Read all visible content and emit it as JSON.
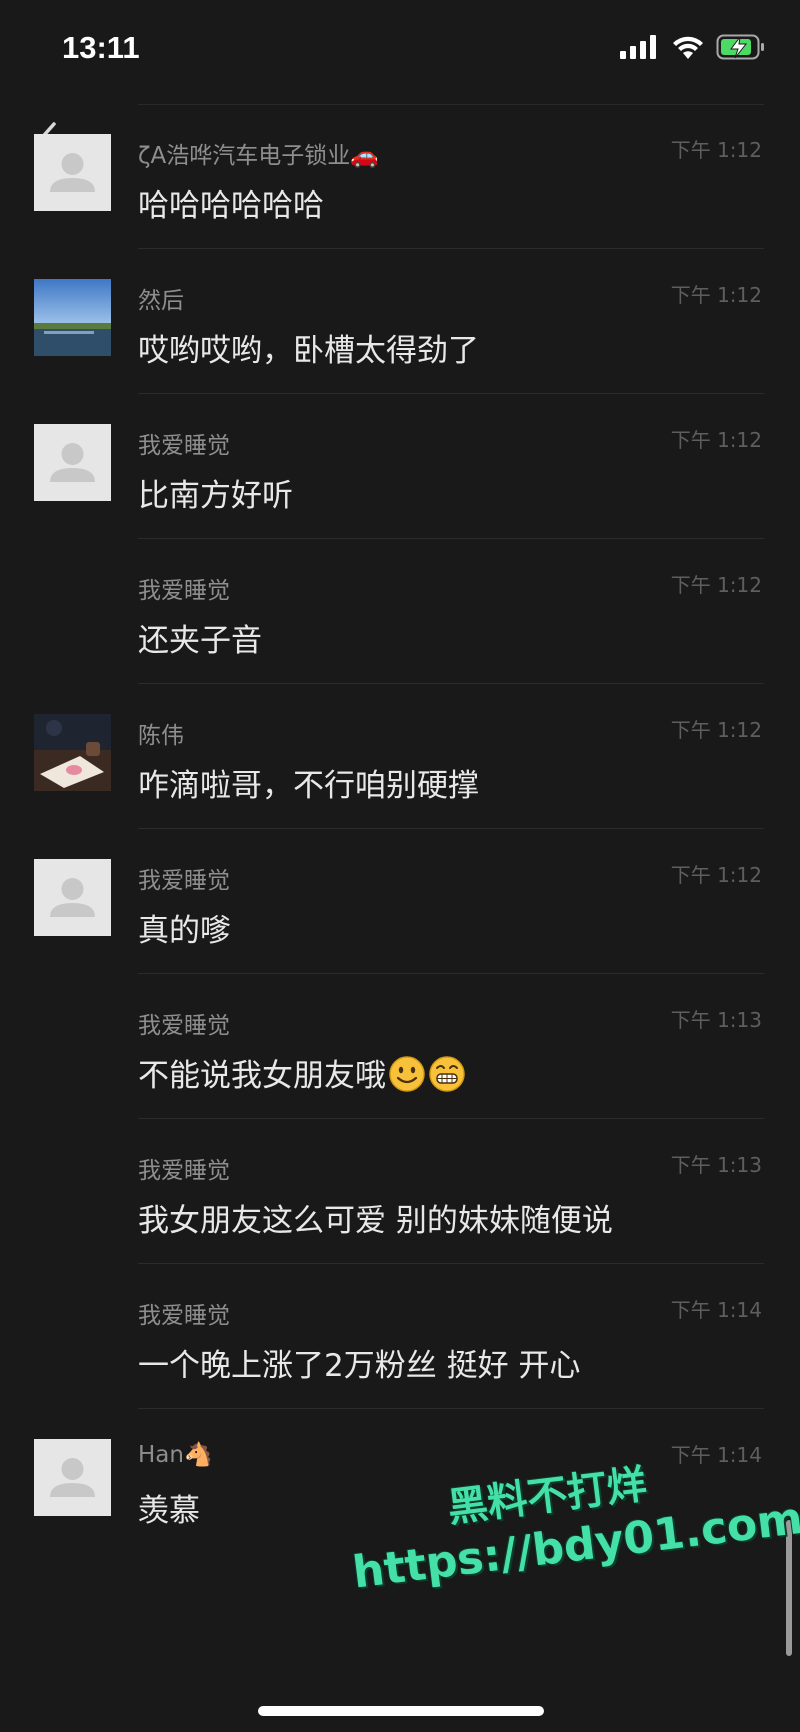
{
  "status_bar": {
    "time": "13:11"
  },
  "messages": [
    {
      "sender": "ζA浩哗汽车电子锁业",
      "sender_emoji": "🚗",
      "time": "下午 1:12",
      "text": "哈哈哈哈哈哈",
      "avatar": "default"
    },
    {
      "sender": "然后",
      "time": "下午 1:12",
      "text": "哎哟哎哟，卧槽太得劲了",
      "avatar": "landscape-photo"
    },
    {
      "sender": "我爱睡觉",
      "time": "下午 1:12",
      "text": "比南方好听",
      "avatar": "default"
    },
    {
      "sender": "我爱睡觉",
      "time": "下午 1:12",
      "text": "还夹子音",
      "avatar": "none"
    },
    {
      "sender": "陈伟",
      "time": "下午 1:12",
      "text": "咋滴啦哥，不行咱别硬撑",
      "avatar": "dinner-photo"
    },
    {
      "sender": "我爱睡觉",
      "time": "下午 1:12",
      "text": "真的嗲",
      "avatar": "default"
    },
    {
      "sender": "我爱睡觉",
      "time": "下午 1:13",
      "text": "不能说我女朋友哦",
      "emojis": [
        "smile-face",
        "grin-face"
      ],
      "avatar": "none"
    },
    {
      "sender": "我爱睡觉",
      "time": "下午 1:13",
      "text": "我女朋友这么可爱 别的妹妹随便说",
      "avatar": "none"
    },
    {
      "sender": "我爱睡觉",
      "time": "下午 1:14",
      "text": "一个晚上涨了2万粉丝 挺好 开心",
      "avatar": "none"
    },
    {
      "sender": "Han",
      "sender_emoji": "🐴",
      "time": "下午 1:14",
      "text": "羡慕",
      "avatar": "default"
    }
  ],
  "watermark": {
    "line1": "黑料不打烊",
    "line2": "https://bdy01.com"
  },
  "colors": {
    "background": "#191919",
    "watermark": "#44e0a8",
    "text": "#e8e8e8",
    "meta": "#8e8e8e"
  }
}
